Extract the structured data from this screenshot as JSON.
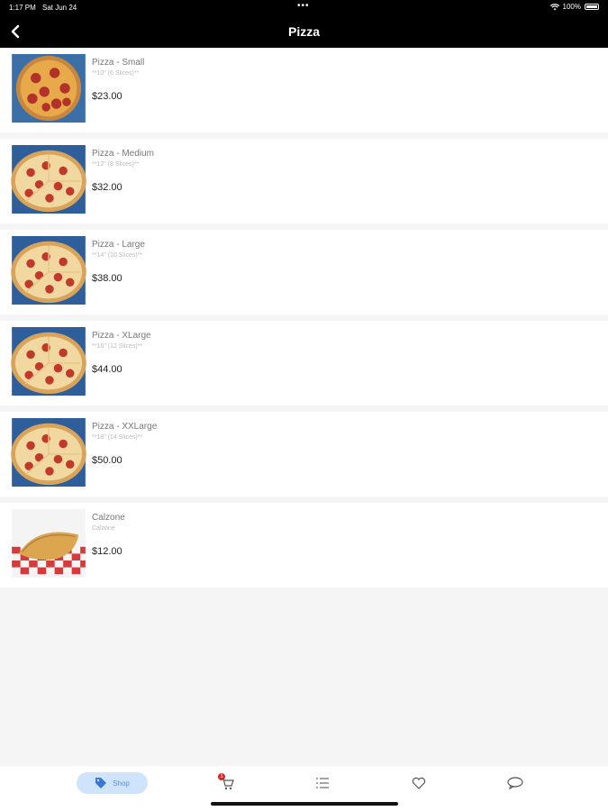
{
  "status": {
    "time": "1:17 PM",
    "date": "Sat Jun 24",
    "dots": "•••",
    "battery": "100%"
  },
  "nav": {
    "title": "Pizza",
    "back_icon": "chevron-left-icon"
  },
  "items": [
    {
      "name": "Pizza - Small",
      "desc": "**10\" (6 Slices)**",
      "price": "$23.00",
      "image": "pepperoni-pizza"
    },
    {
      "name": "Pizza - Medium",
      "desc": "**12\" (8 Slices)**",
      "price": "$32.00",
      "image": "pepperoni-pizza"
    },
    {
      "name": "Pizza - Large",
      "desc": "**14\" (10 Slices)**",
      "price": "$38.00",
      "image": "pepperoni-pizza"
    },
    {
      "name": "Pizza - XLarge",
      "desc": "**16\" (12 Slices)**",
      "price": "$44.00",
      "image": "pepperoni-pizza"
    },
    {
      "name": "Pizza - XXLarge",
      "desc": "**18\" (14 Slices)**",
      "price": "$50.00",
      "image": "pepperoni-pizza"
    },
    {
      "name": "Calzone",
      "desc": "Calzone",
      "price": "$12.00",
      "image": "calzone"
    }
  ],
  "tabs": {
    "shop": {
      "label": "Shop",
      "icon": "tag-icon"
    },
    "cart": {
      "badge": "1",
      "icon": "cart-icon"
    },
    "list": {
      "icon": "list-icon"
    },
    "favorites": {
      "icon": "heart-icon"
    },
    "chat": {
      "icon": "chat-icon"
    }
  },
  "colors": {
    "accent": "#5b8fd3",
    "accent_bg": "#cfe3fb",
    "badge": "#e02424",
    "header": "#000000"
  }
}
